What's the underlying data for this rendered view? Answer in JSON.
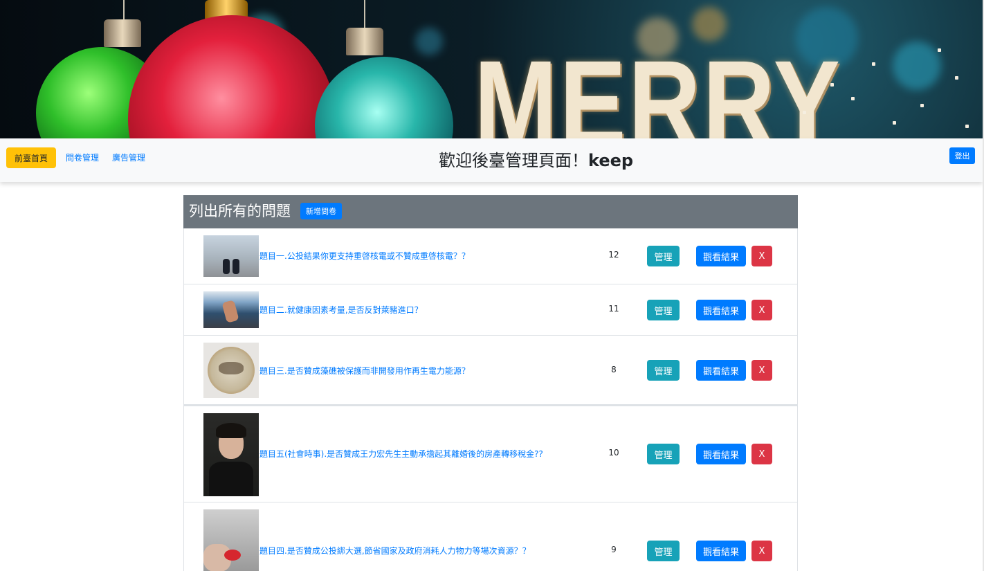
{
  "banner": {
    "text": "MERRY"
  },
  "navbar": {
    "home_label": "前臺首頁",
    "links": [
      "問卷管理",
      "廣告管理"
    ],
    "title_prefix": "歡迎後臺管理頁面！",
    "username": "keep",
    "logout_label": "登出"
  },
  "panel": {
    "heading": "列出所有的問題",
    "new_button_label": "新增問卷",
    "rows": [
      {
        "question": "題目一.公投結果你更支持重啓核電或不贊成重啓核電？？",
        "count": "12",
        "manage": "管理",
        "result": "觀看結果",
        "delete": "X"
      },
      {
        "question": "題目二.就健康因素考量,是否反對萊豬進口？",
        "count": "11",
        "manage": "管理",
        "result": "觀看結果",
        "delete": "X"
      },
      {
        "question": "題目三.是否贊成藻礁被保護而非開發用作再生電力能源？",
        "count": "8",
        "manage": "管理",
        "result": "觀看結果",
        "delete": "X"
      },
      {
        "question": "題目五(社會時事).是否贊成王力宏先生主動承擔起其離婚後的房產轉移稅金??",
        "count": "10",
        "manage": "管理",
        "result": "觀看結果",
        "delete": "X"
      },
      {
        "question": "題目四.是否贊成公投綁大選,節省國家及政府消耗人力物力等場次資源？？",
        "count": "9",
        "manage": "管理",
        "result": "觀看結果",
        "delete": "X"
      }
    ]
  },
  "colors": {
    "primary": "#007bff",
    "info": "#17a2b8",
    "danger": "#dc3545",
    "warning": "#ffc107",
    "secondary": "#6c757d"
  }
}
